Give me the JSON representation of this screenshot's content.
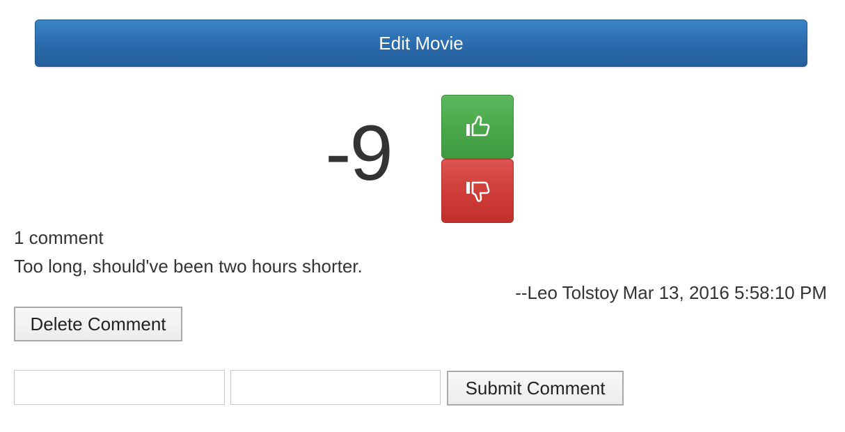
{
  "header": {
    "edit_label": "Edit Movie"
  },
  "votes": {
    "score": "-9",
    "upvote_icon": "thumbs-up-icon",
    "downvote_icon": "thumbs-down-icon",
    "upvote_color": "#5cb85c",
    "downvote_color": "#d9534f"
  },
  "comments": {
    "count_label": "1 comment",
    "items": [
      {
        "text": "Too long, should've been two hours shorter.",
        "author": "--Leo Tolstoy",
        "timestamp": "Mar 13, 2016 5:58:10 PM",
        "delete_label": "Delete Comment"
      }
    ]
  },
  "new_comment": {
    "field_1_value": "",
    "field_2_value": "",
    "submit_label": "Submit Comment"
  },
  "colors": {
    "primary": "#337ab7"
  }
}
